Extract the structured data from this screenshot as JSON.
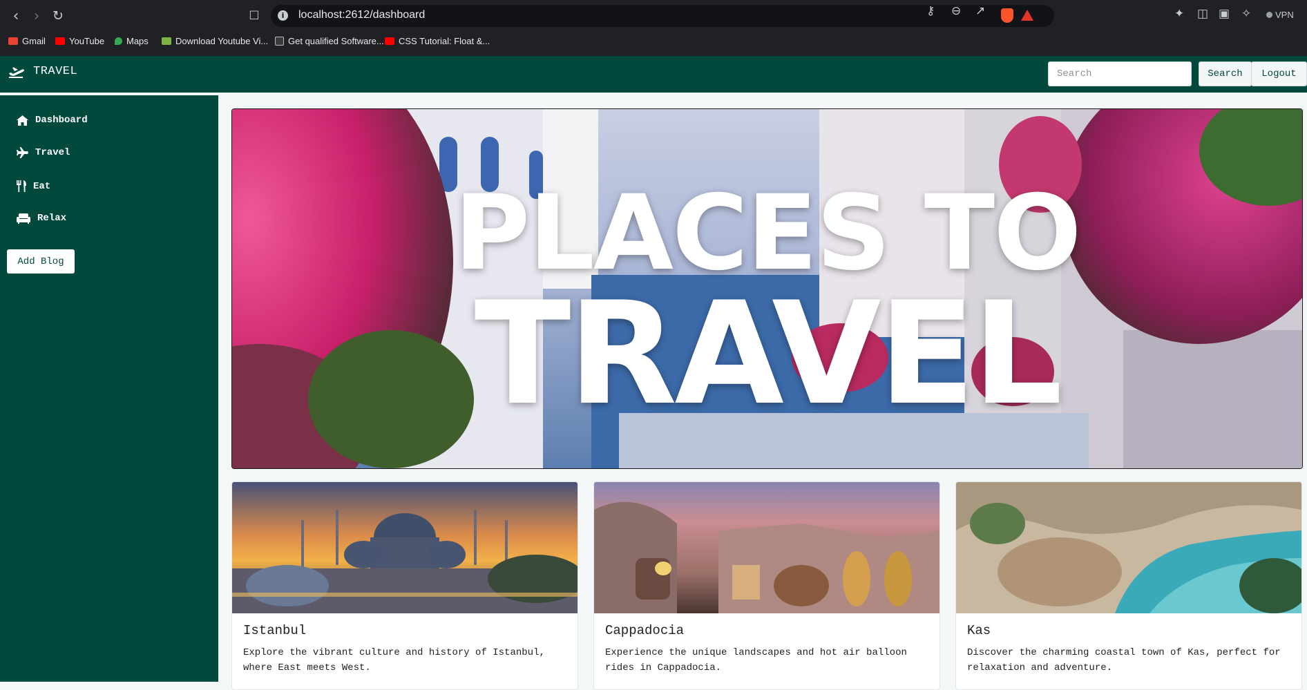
{
  "browser": {
    "url": "localhost:2612/dashboard",
    "vpn_label": "VPN",
    "bookmarks": [
      {
        "label": "Gmail",
        "color": "#ea4335"
      },
      {
        "label": "YouTube",
        "color": "#ff0000"
      },
      {
        "label": "Maps",
        "color": "#34a853"
      },
      {
        "label": "Download Youtube Vi...",
        "color": "#7cb342"
      },
      {
        "label": "Get qualified Software...",
        "color": "#ffffff"
      },
      {
        "label": "CSS Tutorial: Float &...",
        "color": "#ff0000"
      }
    ]
  },
  "navbar": {
    "brand": "TRAVEL",
    "search_placeholder": "Search",
    "search_button": "Search",
    "logout_button": "Logout",
    "bg_color": "#02493d"
  },
  "sidebar": {
    "items": [
      {
        "label": "Dashboard",
        "icon": "home-icon"
      },
      {
        "label": "Travel",
        "icon": "plane-icon"
      },
      {
        "label": "Eat",
        "icon": "utensils-icon"
      },
      {
        "label": "Relax",
        "icon": "couch-icon"
      }
    ],
    "add_blog_button": "Add Blog"
  },
  "hero": {
    "line1": "PLACES TO",
    "line2": "TRAVEL"
  },
  "cards": [
    {
      "title": "Istanbul",
      "description": "Explore the vibrant culture and history of Istanbul, where East meets West."
    },
    {
      "title": "Cappadocia",
      "description": "Experience the unique landscapes and hot air balloon rides in Cappadocia."
    },
    {
      "title": "Kas",
      "description": "Discover the charming coastal town of Kas, perfect for relaxation and adventure."
    }
  ]
}
